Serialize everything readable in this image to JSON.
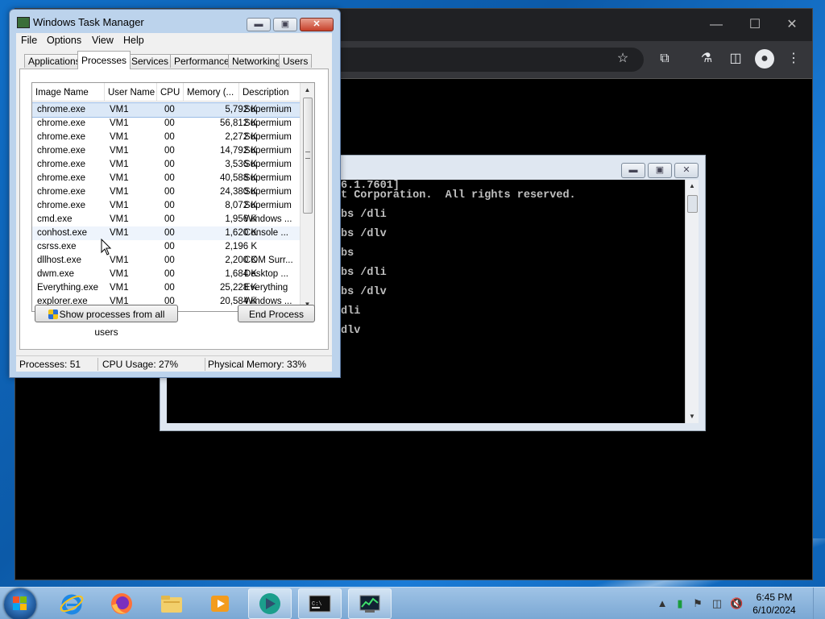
{
  "task_manager": {
    "title": "Windows Task Manager",
    "menu": [
      "File",
      "Options",
      "View",
      "Help"
    ],
    "tabs": [
      "Applications",
      "Processes",
      "Services",
      "Performance",
      "Networking",
      "Users"
    ],
    "active_tab": "Processes",
    "columns": [
      "Image Name",
      "User Name",
      "CPU",
      "Memory (...",
      "Description"
    ],
    "rows": [
      {
        "name": "chrome.exe",
        "user": "VM1",
        "cpu": "00",
        "mem": "5,792 K",
        "desc": "Supermium"
      },
      {
        "name": "chrome.exe",
        "user": "VM1",
        "cpu": "00",
        "mem": "56,812 K",
        "desc": "Supermium"
      },
      {
        "name": "chrome.exe",
        "user": "VM1",
        "cpu": "00",
        "mem": "2,272 K",
        "desc": "Supermium"
      },
      {
        "name": "chrome.exe",
        "user": "VM1",
        "cpu": "00",
        "mem": "14,792 K",
        "desc": "Supermium"
      },
      {
        "name": "chrome.exe",
        "user": "VM1",
        "cpu": "00",
        "mem": "3,536 K",
        "desc": "Supermium"
      },
      {
        "name": "chrome.exe",
        "user": "VM1",
        "cpu": "00",
        "mem": "40,588 K",
        "desc": "Supermium"
      },
      {
        "name": "chrome.exe",
        "user": "VM1",
        "cpu": "00",
        "mem": "24,380 K",
        "desc": "Supermium"
      },
      {
        "name": "chrome.exe",
        "user": "VM1",
        "cpu": "00",
        "mem": "8,072 K",
        "desc": "Supermium"
      },
      {
        "name": "cmd.exe",
        "user": "VM1",
        "cpu": "00",
        "mem": "1,956 K",
        "desc": "Windows ..."
      },
      {
        "name": "conhost.exe",
        "user": "VM1",
        "cpu": "00",
        "mem": "1,620 K",
        "desc": "Console ..."
      },
      {
        "name": "csrss.exe",
        "user": "",
        "cpu": "00",
        "mem": "2,196 K",
        "desc": ""
      },
      {
        "name": "dllhost.exe",
        "user": "VM1",
        "cpu": "00",
        "mem": "2,200 K",
        "desc": "COM Surr..."
      },
      {
        "name": "dwm.exe",
        "user": "VM1",
        "cpu": "00",
        "mem": "1,684 K",
        "desc": "Desktop ..."
      },
      {
        "name": "Everything.exe",
        "user": "VM1",
        "cpu": "00",
        "mem": "25,228 K",
        "desc": "Everything"
      },
      {
        "name": "explorer.exe",
        "user": "VM1",
        "cpu": "00",
        "mem": "20,584 K",
        "desc": "Windows ..."
      }
    ],
    "show_all_label": "Show processes from all users",
    "end_process_label": "End Process",
    "status": {
      "processes": "Processes: 51",
      "cpu": "CPU Usage: 27%",
      "memory": "Physical Memory: 33%"
    }
  },
  "cmd": {
    "lines": [
      "6.1.7601]",
      "t Corporation.  All rights reserved.",
      "",
      "bs /dli",
      "",
      "bs /dlv",
      "",
      "bs",
      "",
      "bs /dli",
      "",
      "bs /dlv",
      "",
      "dli",
      "",
      "dlv"
    ]
  },
  "taskbar": {
    "time": "6:45 PM",
    "date": "6/10/2024",
    "pinned_icons": [
      "internet-explorer-icon",
      "firefox-icon",
      "file-explorer-icon",
      "media-player-icon",
      "supermium-icon",
      "cmd-icon",
      "task-manager-icon"
    ]
  },
  "colors": {
    "desktop": "#1170c9",
    "taskbar": "#8db6dd",
    "selection": "#dbe8f7"
  }
}
